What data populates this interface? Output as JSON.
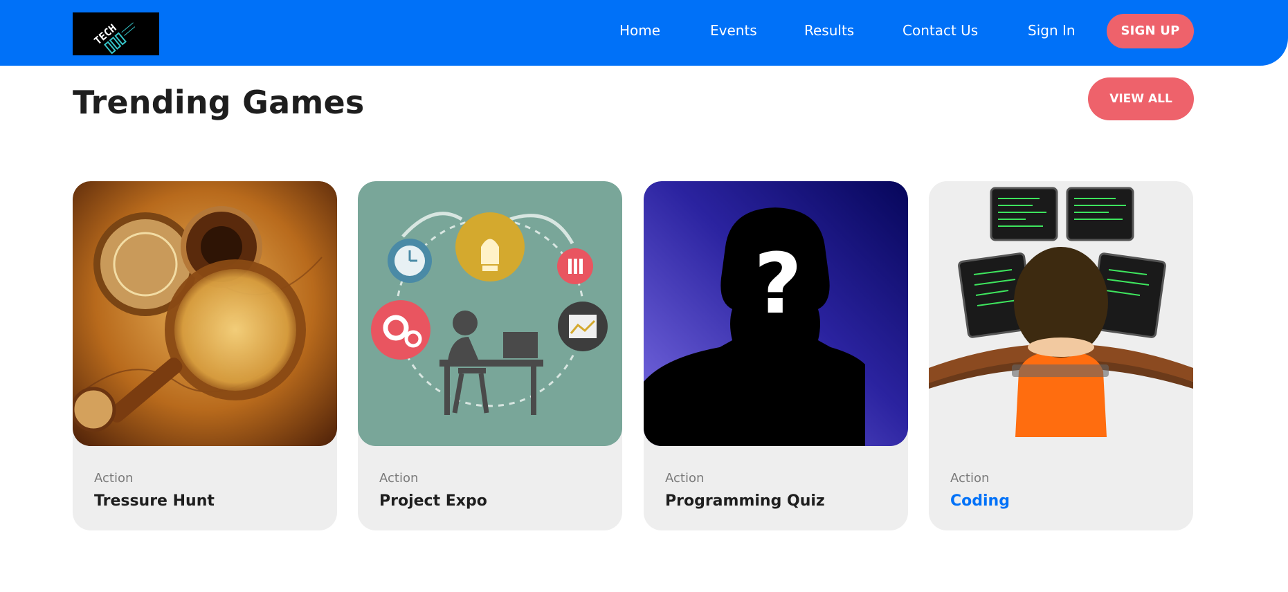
{
  "header": {
    "logo": {
      "text": "TECH",
      "icon": "tech-fest-logo"
    },
    "nav": [
      "Home",
      "Events",
      "Results",
      "Contact Us",
      "Sign In"
    ],
    "signup_label": "SIGN UP"
  },
  "section": {
    "title": "Trending Games",
    "view_all_label": "VIEW ALL"
  },
  "games": [
    {
      "category": "Action",
      "name": "Tressure Hunt",
      "image": "treasure-map-compass"
    },
    {
      "category": "Action",
      "name": "Project Expo",
      "image": "project-workflow-illustration"
    },
    {
      "category": "Action",
      "name": "Programming Quiz",
      "image": "mystery-silhouette"
    },
    {
      "category": "Action",
      "name": "Coding",
      "image": "programmer-at-monitors"
    }
  ],
  "colors": {
    "header_bg": "#0071f8",
    "accent_button": "#ee626b",
    "card_bg": "#eeeeee",
    "active_link": "#0071f8"
  }
}
